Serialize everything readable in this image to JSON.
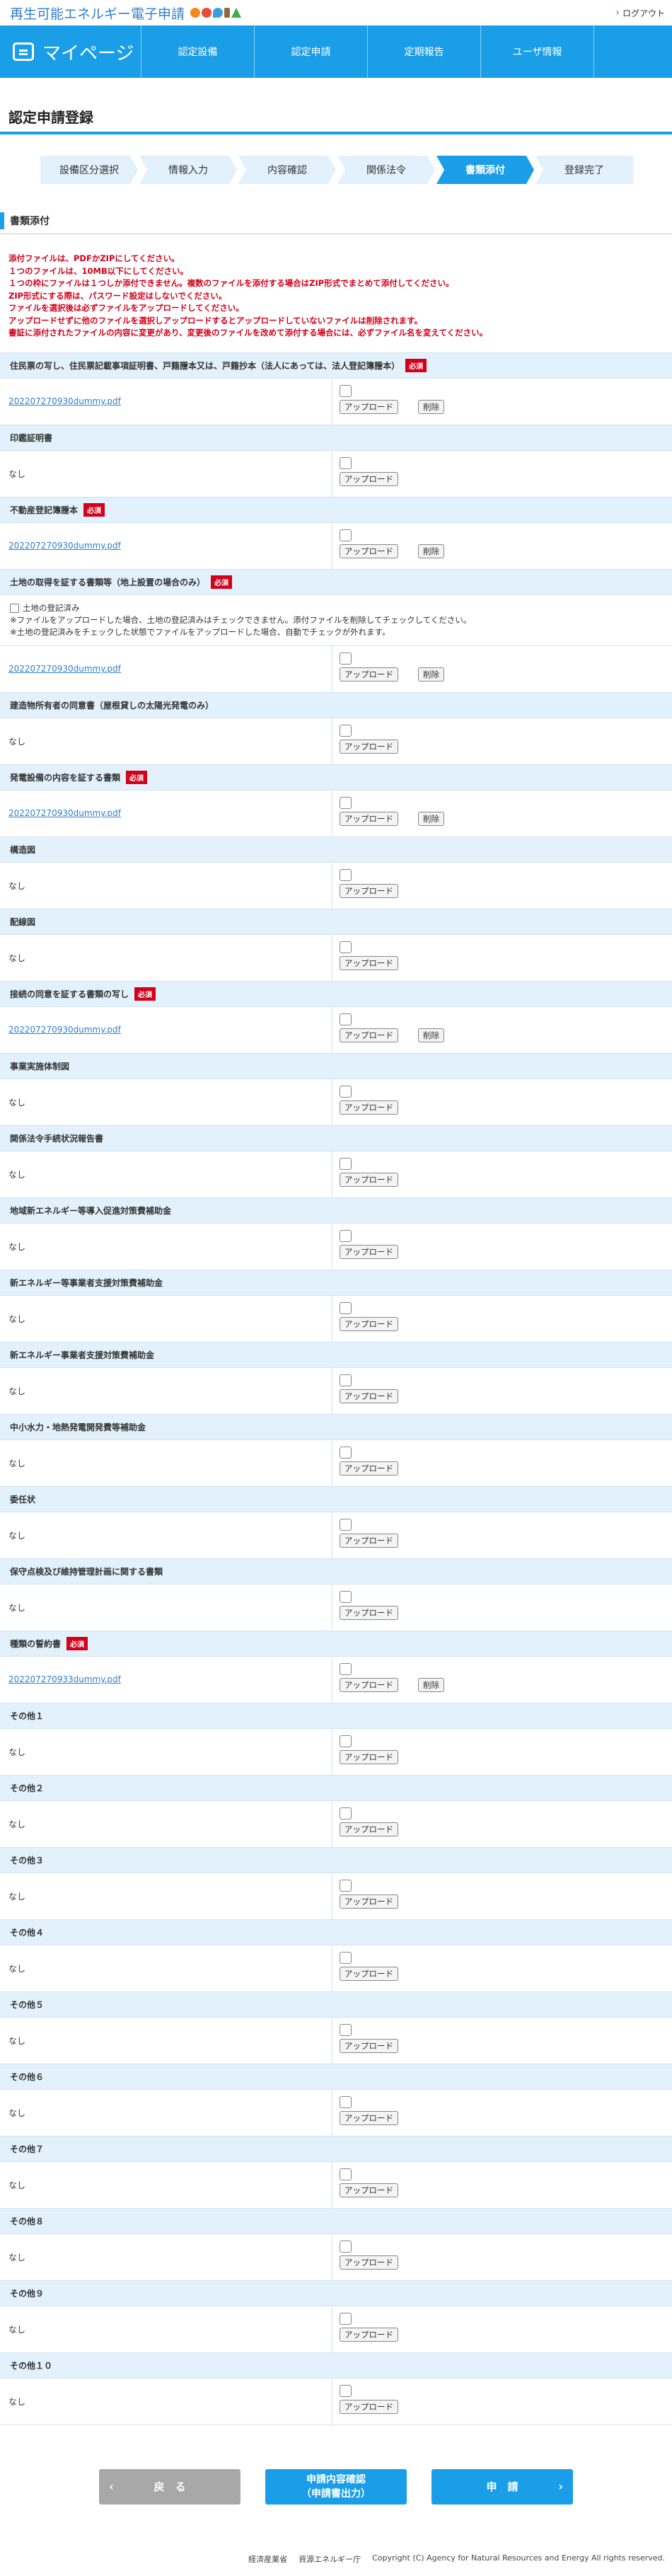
{
  "header": {
    "logo_text": "再生可能エネルギー電子申請",
    "logout_label": "ログアウト"
  },
  "nav": {
    "mypage": "マイページ",
    "items": [
      "認定設備",
      "認定申請",
      "定期報告",
      "ユーザ情報"
    ]
  },
  "page_title": "認定申請登録",
  "steps": [
    "設備区分選択",
    "情報入力",
    "内容確認",
    "関係法令",
    "書類添付",
    "登録完了"
  ],
  "section_title": "書類添付",
  "notes": [
    "添付ファイルは、PDFかZIPにしてください。",
    "１つのファイルは、10MB以下にしてください。",
    "１つの枠にファイルは１つしか添付できません。複数のファイルを添付する場合はZIP形式でまとめて添付してください。",
    "ZIP形式にする際は、パスワード設定はしないでください。",
    "ファイルを選択後は必ずファイルをアップロードしてください。",
    "アップロードせずに他のファイルを選択しアップロードするとアップロードしていないファイルは削除されます。",
    "書証に添付されたファイルの内容に変更があり、変更後のファイルを改めて添付する場合には、必ずファイル名を変えてください。"
  ],
  "labels": {
    "none": "なし",
    "upload": "アップロード",
    "delete": "削除",
    "required": "必須"
  },
  "land_extra": {
    "checkbox_label": "土地の登記済み",
    "note1": "※ファイルをアップロードした場合、土地の登記済みはチェックできません。添付ファイルを削除してチェックしてください。",
    "note2": "※土地の登記済みをチェックした状態でファイルをアップロードした場合、自動でチェックが外れます。"
  },
  "documents": [
    {
      "title": "住民票の写し、住民票記載事項証明書、戸籍謄本又は、戸籍抄本（法人にあっては、法人登記簿謄本）",
      "required": true,
      "file": "20220727093​0dummy.pdf"
    },
    {
      "title": "印鑑証明書",
      "required": false,
      "file": ""
    },
    {
      "title": "不動産登記簿謄本",
      "required": true,
      "file": "202207270930dummy.pdf"
    },
    {
      "title": "土地の取得を証する書類等（地上設置の場合のみ）",
      "required": true,
      "file": "202207270930dummy.pdf",
      "land": true
    },
    {
      "title": "建造物所有者の同意書（屋根貸しの太陽光発電のみ）",
      "required": false,
      "file": ""
    },
    {
      "title": "発電設備の内容を証する書類",
      "required": true,
      "file": "202207270930dummy.pdf"
    },
    {
      "title": "構造図",
      "required": false,
      "file": ""
    },
    {
      "title": "配線図",
      "required": false,
      "file": ""
    },
    {
      "title": "接続の同意を証する書類の写し",
      "required": true,
      "file": "202207270930dummy.pdf"
    },
    {
      "title": "事業実施体制図",
      "required": false,
      "file": ""
    },
    {
      "title": "関係法令手続状況報告書",
      "required": false,
      "file": ""
    },
    {
      "title": "地域新エネルギー等導入促進対策費補助金",
      "required": false,
      "file": ""
    },
    {
      "title": "新エネルギー等事業者支援対策費補助金",
      "required": false,
      "file": ""
    },
    {
      "title": "新エネルギー事業者支援対策費補助金",
      "required": false,
      "file": ""
    },
    {
      "title": "中小水力・地熱発電開発費等補助金",
      "required": false,
      "file": ""
    },
    {
      "title": "委任状",
      "required": false,
      "file": ""
    },
    {
      "title": "保守点検及び維持管理計画に関する書類",
      "required": false,
      "file": ""
    },
    {
      "title": "種類の誓約書",
      "required": true,
      "file": "202207270933dummy.pdf"
    },
    {
      "title": "その他１",
      "required": false,
      "file": ""
    },
    {
      "title": "その他２",
      "required": false,
      "file": ""
    },
    {
      "title": "その他３",
      "required": false,
      "file": ""
    },
    {
      "title": "その他４",
      "required": false,
      "file": ""
    },
    {
      "title": "その他５",
      "required": false,
      "file": ""
    },
    {
      "title": "その他６",
      "required": false,
      "file": ""
    },
    {
      "title": "その他７",
      "required": false,
      "file": ""
    },
    {
      "title": "その他８",
      "required": false,
      "file": ""
    },
    {
      "title": "その他９",
      "required": false,
      "file": ""
    },
    {
      "title": "その他１０",
      "required": false,
      "file": ""
    }
  ],
  "footer_buttons": {
    "back": "戻　る",
    "confirm_line1": "申請内容確認",
    "confirm_line2": "（申請書出力）",
    "apply": "申　請"
  },
  "footer": {
    "ministry": "経済産業省",
    "agency": "資源エネルギー庁",
    "copyright": "Copyright (C) Agency for Natural Resources and Energy All rights reserved."
  }
}
